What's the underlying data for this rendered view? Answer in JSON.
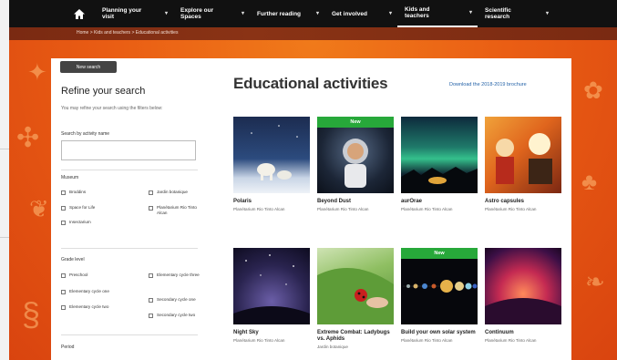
{
  "nav": {
    "items": [
      {
        "label": "Planning your visit"
      },
      {
        "label": "Explore our Spaces"
      },
      {
        "label": "Further reading"
      },
      {
        "label": "Get involved"
      },
      {
        "label": "Kids and teachers",
        "active": true
      },
      {
        "label": "Scientific research"
      }
    ]
  },
  "breadcrumb": "Home > Kids and teachers > Educational activities",
  "sidebar": {
    "new_search": "New search",
    "refine_title": "Refine your search",
    "refine_sub": "You may refine your search using the filters below:",
    "search_label": "Search by activity name",
    "search_placeholder": "",
    "museum_label": "Museum",
    "museum_options": [
      "Broddins",
      "Space for Life",
      "Insectarium",
      "Jardin botanique",
      "Planétarium Rio Tinto Alcan"
    ],
    "grade_label": "Grade level",
    "grade_options": [
      "Preschool",
      "Elementary cycle one",
      "Elementary cycle two",
      "Elementary cycle three",
      "Secondary cycle one",
      "Secondary cycle two"
    ],
    "period_label": "Period"
  },
  "main": {
    "title": "Educational activities",
    "download_link": "Download the 2018-2019 brochure",
    "cards": [
      {
        "title": "Polaris",
        "subtitle": "Planétarium Rio Tinto Alcan",
        "new": false
      },
      {
        "title": "Beyond Dust",
        "subtitle": "Planétarium Rio Tinto Alcan",
        "new": true,
        "new_label": "New"
      },
      {
        "title": "aurOrae",
        "subtitle": "Planétarium Rio Tinto Alcan",
        "new": false
      },
      {
        "title": "Astro capsules",
        "subtitle": "Planétarium Rio Tinto Alcan",
        "new": false
      },
      {
        "title": "Night Sky",
        "subtitle": "Planétarium Rio Tinto Alcan",
        "new": false
      },
      {
        "title": "Extreme Combat: Ladybugs vs. Aphids",
        "subtitle": "Jardin botanique",
        "new": false
      },
      {
        "title": "Build your own solar system",
        "subtitle": "Planétarium Rio Tinto Alcan",
        "new": true,
        "new_label": "New"
      },
      {
        "title": "Continuum",
        "subtitle": "Planétarium Rio Tinto Alcan",
        "new": false
      }
    ]
  },
  "colors": {
    "nav_bg": "#111111",
    "crumb_bg": "#7a2a12",
    "background_orange": "#ea5e14",
    "new_badge": "#27a83a",
    "link": "#2563a8"
  }
}
